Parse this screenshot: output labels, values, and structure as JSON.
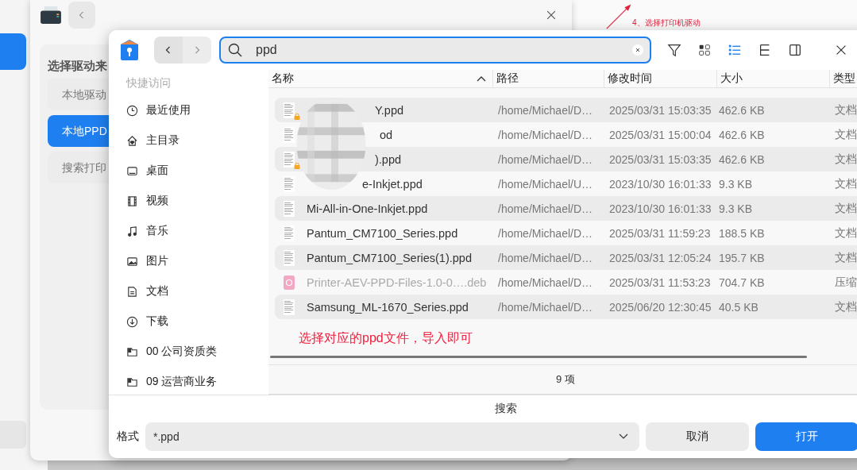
{
  "back_window": {
    "sidebar": [
      {
        "selected": true
      }
    ],
    "heading": "选择驱动来",
    "sources": [
      {
        "label": "本地驱动",
        "selected": false
      },
      {
        "label": "本地PPD",
        "selected": true
      },
      {
        "label": "搜索打印",
        "selected": false
      }
    ],
    "note": "4、选择打印机驱动"
  },
  "dialog": {
    "search": {
      "value": "ppd"
    },
    "sidebar": {
      "heading": "快捷访问",
      "items": [
        {
          "kind": "recent",
          "label": "最近使用"
        },
        {
          "kind": "home",
          "label": "主目录"
        },
        {
          "kind": "desktop",
          "label": "桌面"
        },
        {
          "kind": "video",
          "label": "视频"
        },
        {
          "kind": "music",
          "label": "音乐"
        },
        {
          "kind": "picture",
          "label": "图片"
        },
        {
          "kind": "document",
          "label": "文档"
        },
        {
          "kind": "download",
          "label": "下载"
        },
        {
          "kind": "folder",
          "label": "00 公司资质类"
        },
        {
          "kind": "folder",
          "label": "09 运营商业务"
        }
      ]
    },
    "columns": [
      "名称",
      "路径",
      "修改时间",
      "大小",
      "类型"
    ],
    "rows": [
      {
        "kind": "ppd",
        "locked": true,
        "name": "Y.ppd",
        "path": "/home/Michael/D…",
        "modified": "2025/03/31 15:03:35",
        "size": "462.6 KB",
        "type": "文档"
      },
      {
        "kind": "ppd",
        "locked": false,
        "name": "od",
        "path": "/home/Michael/D…",
        "modified": "2025/03/31 15:00:04",
        "size": "462.6 KB",
        "type": "文档"
      },
      {
        "kind": "ppd",
        "locked": true,
        "name": ").ppd",
        "path": "/home/Michael/D…",
        "modified": "2025/03/31 15:03:35",
        "size": "462.6 KB",
        "type": "文档"
      },
      {
        "kind": "ppd",
        "locked": false,
        "name": "e-Inkjet.ppd",
        "path": "/home/Michael/U…",
        "modified": "2023/10/30 16:01:33",
        "size": "9.3 KB",
        "type": "文档"
      },
      {
        "kind": "ppd",
        "locked": false,
        "name": "Mi-All-in-One-Inkjet.ppd",
        "path": "/home/Michael/D…",
        "modified": "2023/10/30 16:01:33",
        "size": "9.3 KB",
        "type": "文档"
      },
      {
        "kind": "ppd",
        "locked": false,
        "name": "Pantum_CM7100_Series.ppd",
        "path": "/home/Michael/D…",
        "modified": "2025/03/31 11:59:23",
        "size": "188.5 KB",
        "type": "文档"
      },
      {
        "kind": "ppd",
        "locked": false,
        "name": "Pantum_CM7100_Series(1).ppd",
        "path": "/home/Michael/D…",
        "modified": "2025/03/31 12:05:24",
        "size": "195.7 KB",
        "type": "文档"
      },
      {
        "kind": "deb",
        "locked": false,
        "name": "Printer-AEV-PPD-Files-1.0-0….deb",
        "path": "/home/Michael/D…",
        "modified": "2025/03/31 11:53:23",
        "size": "704.7 KB",
        "type": "压缩"
      },
      {
        "kind": "ppd",
        "locked": false,
        "name": "Samsung_ML-1670_Series.ppd",
        "path": "/home/Michael/D…",
        "modified": "2025/06/20 12:30:45",
        "size": "40.5 KB",
        "type": "文档"
      }
    ],
    "annotation": "选择对应的ppd文件，导入即可",
    "count": "9 项",
    "section": "搜索",
    "format_label": "格式",
    "format_value": "*.ppd",
    "buttons": [
      {
        "label": "取消",
        "kind": "plain"
      },
      {
        "label": "打开",
        "kind": "primary"
      }
    ]
  }
}
